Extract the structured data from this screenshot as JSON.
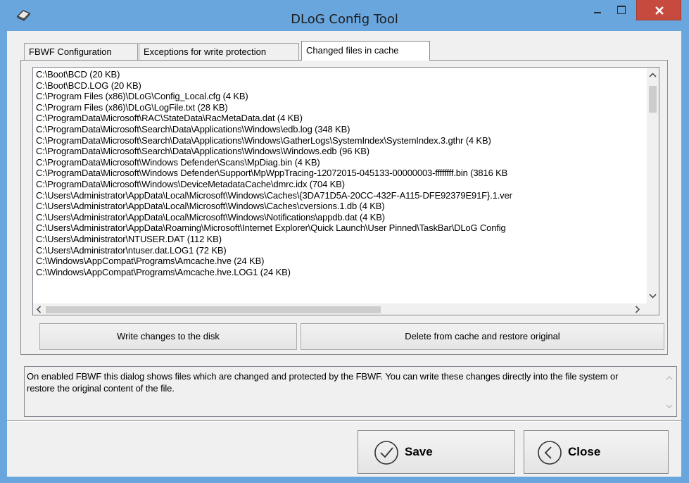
{
  "window": {
    "title": "DLoG Config Tool",
    "icon": "app-gear-icon",
    "controls": [
      "minimize-icon",
      "maximize-icon",
      "close-icon"
    ],
    "accent_color": "#6aa6de",
    "close_color": "#c74a3e"
  },
  "tabs": [
    {
      "label": "FBWF Configuration"
    },
    {
      "label": "Exceptions for write protection"
    },
    {
      "label": "Changed files in cache",
      "selected": true
    }
  ],
  "files": [
    "C:\\Boot\\BCD  (20 KB)",
    "C:\\Boot\\BCD.LOG  (20 KB)",
    "C:\\Program Files (x86)\\DLoG\\Config_Local.cfg  (4 KB)",
    "C:\\Program Files (x86)\\DLoG\\LogFile.txt  (28 KB)",
    "C:\\ProgramData\\Microsoft\\RAC\\StateData\\RacMetaData.dat  (4 KB)",
    "C:\\ProgramData\\Microsoft\\Search\\Data\\Applications\\Windows\\edb.log  (348 KB)",
    "C:\\ProgramData\\Microsoft\\Search\\Data\\Applications\\Windows\\GatherLogs\\SystemIndex\\SystemIndex.3.gthr  (4 KB)",
    "C:\\ProgramData\\Microsoft\\Search\\Data\\Applications\\Windows\\Windows.edb  (96 KB)",
    "C:\\ProgramData\\Microsoft\\Windows Defender\\Scans\\MpDiag.bin  (4 KB)",
    "C:\\ProgramData\\Microsoft\\Windows Defender\\Support\\MpWppTracing-12072015-045133-00000003-ffffffff.bin  (3816 KB",
    "C:\\ProgramData\\Microsoft\\Windows\\DeviceMetadataCache\\dmrc.idx  (704 KB)",
    "C:\\Users\\Administrator\\AppData\\Local\\Microsoft\\Windows\\Caches\\{3DA71D5A-20CC-432F-A115-DFE92379E91F}.1.ver",
    "C:\\Users\\Administrator\\AppData\\Local\\Microsoft\\Windows\\Caches\\cversions.1.db  (4 KB)",
    "C:\\Users\\Administrator\\AppData\\Local\\Microsoft\\Windows\\Notifications\\appdb.dat  (4 KB)",
    "C:\\Users\\Administrator\\AppData\\Roaming\\Microsoft\\Internet Explorer\\Quick Launch\\User Pinned\\TaskBar\\DLoG Config",
    "C:\\Users\\Administrator\\NTUSER.DAT  (112 KB)",
    "C:\\Users\\Administrator\\ntuser.dat.LOG1  (72 KB)",
    "C:\\Windows\\AppCompat\\Programs\\Amcache.hve  (24 KB)",
    "C:\\Windows\\AppCompat\\Programs\\Amcache.hve.LOG1  (24 KB)"
  ],
  "buttons": {
    "write": "Write changes to the disk",
    "delete": "Delete from cache and restore original",
    "save": "Save",
    "close": "Close"
  },
  "description": "On enabled FBWF this dialog shows files which are changed and protected by the FBWF. You can write these changes directly into the file system or restore the original content of the file."
}
